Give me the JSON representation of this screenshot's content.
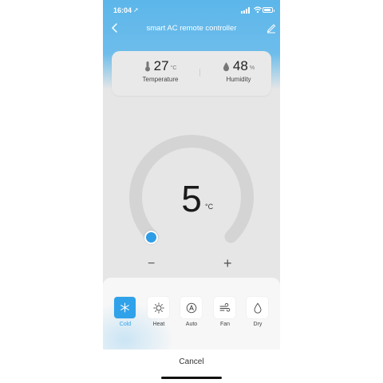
{
  "status_bar": {
    "time": "16:04"
  },
  "nav": {
    "title": "smart AC remote controller"
  },
  "sensors": {
    "temperature": {
      "value": "27",
      "unit": "°C",
      "label": "Temperature"
    },
    "humidity": {
      "value": "48",
      "unit": "%",
      "label": "Humidity"
    }
  },
  "dial": {
    "setpoint": "5",
    "unit": "°C",
    "minus": "−",
    "plus": "+"
  },
  "modes": [
    {
      "label": "Cold",
      "icon": "snowflake-icon",
      "active": true
    },
    {
      "label": "Heat",
      "icon": "sun-icon",
      "active": false
    },
    {
      "label": "Auto",
      "icon": "auto-mode-icon",
      "active": false
    },
    {
      "label": "Fan",
      "icon": "wind-icon",
      "active": false
    },
    {
      "label": "Dry",
      "icon": "droplet-icon",
      "active": false
    }
  ],
  "footer": {
    "cancel_label": "Cancel"
  },
  "colors": {
    "accent": "#2fa2ea",
    "header": "#5cb6ea",
    "background": "#e6e6e6"
  }
}
